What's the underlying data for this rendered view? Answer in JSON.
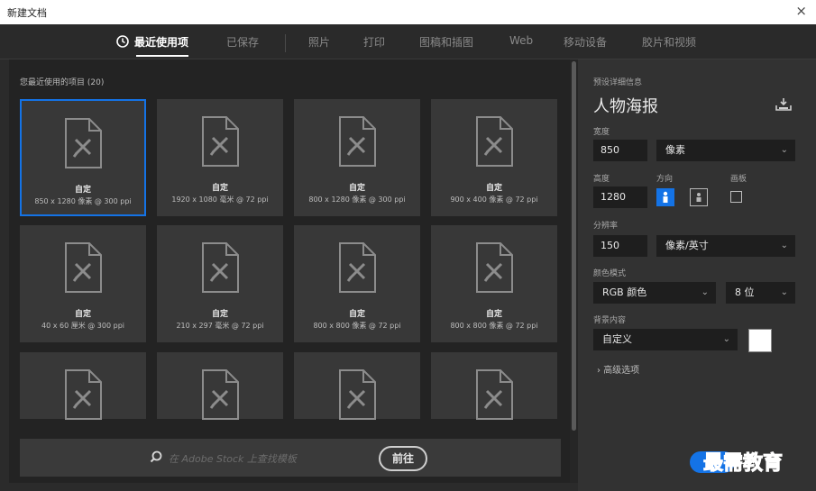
{
  "window": {
    "title": "新建文档",
    "close_symbol": "×"
  },
  "tabs": [
    {
      "label": "最近使用项"
    },
    {
      "label": "已保存"
    },
    {
      "label": "照片"
    },
    {
      "label": "打印"
    },
    {
      "label": "图稿和插图"
    },
    {
      "label": "Web"
    },
    {
      "label": "移动设备"
    },
    {
      "label": "胶片和视频"
    }
  ],
  "recent": {
    "title": "您最近使用的项目",
    "count": "(20)",
    "items": [
      {
        "name": "自定",
        "spec": "850 x 1280 像素 @ 300 ppi"
      },
      {
        "name": "自定",
        "spec": "1920 x 1080 毫米 @ 72 ppi"
      },
      {
        "name": "自定",
        "spec": "800 x 1280 像素 @ 300 ppi"
      },
      {
        "name": "自定",
        "spec": "900 x 400 像素 @ 72 ppi"
      },
      {
        "name": "自定",
        "spec": "40 x 60 厘米 @ 300 ppi"
      },
      {
        "name": "自定",
        "spec": "210 x 297 毫米 @ 72 ppi"
      },
      {
        "name": "自定",
        "spec": "800 x 800 像素 @ 72 ppi"
      },
      {
        "name": "自定",
        "spec": "800 x 800 像素 @ 72 ppi"
      }
    ]
  },
  "search": {
    "placeholder": "在 Adobe Stock 上查找模板",
    "go_label": "前往"
  },
  "details": {
    "header": "预设详细信息",
    "preset_name": "人物海报",
    "width_label": "宽度",
    "width_value": "850",
    "width_unit": "像素",
    "height_label": "高度",
    "height_value": "1280",
    "orientation_label": "方向",
    "artboard_label": "画板",
    "resolution_label": "分辨率",
    "resolution_value": "150",
    "resolution_unit": "像素/英寸",
    "color_mode_label": "颜色模式",
    "color_mode_value": "RGB 颜色",
    "bit_depth_value": "8 位",
    "background_label": "背景内容",
    "background_value": "自定义",
    "advanced_label": "高级选项"
  },
  "watermark": "最需教育",
  "colors": {
    "accent": "#1473e6",
    "background_swatch": "#ffffff"
  }
}
